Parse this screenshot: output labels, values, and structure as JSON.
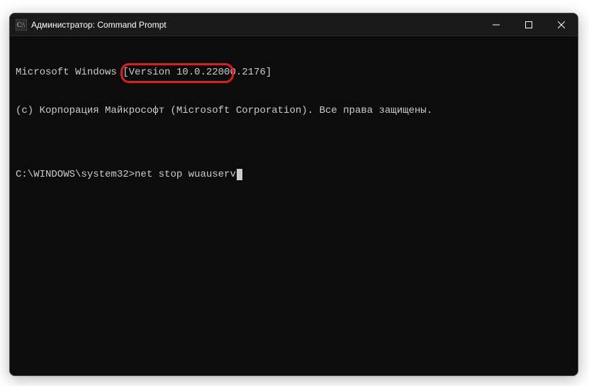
{
  "titlebar": {
    "title": "Администратор: Command Prompt"
  },
  "terminal": {
    "line1": "Microsoft Windows [Version 10.0.22000.2176]",
    "line2": "(c) Корпорация Майкрософт (Microsoft Corporation). Все права защищены.",
    "blank": "",
    "prompt": "C:\\WINDOWS\\system32>",
    "command": "net stop wuauserv"
  }
}
